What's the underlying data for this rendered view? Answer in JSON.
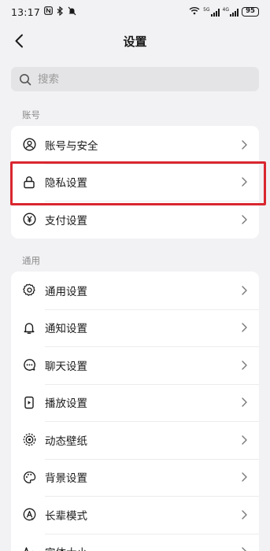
{
  "status_bar": {
    "time": "13:17",
    "left_icons": [
      "nfc-icon",
      "bluetooth-icon",
      "mute-icon"
    ],
    "network_1": "5G",
    "network_2": "4G",
    "battery": "95"
  },
  "header": {
    "title": "设置"
  },
  "search": {
    "placeholder": "搜索"
  },
  "sections": {
    "account": {
      "label": "账号",
      "items": [
        {
          "label": "账号与安全",
          "icon": "person-circle-icon"
        },
        {
          "label": "隐私设置",
          "icon": "lock-icon"
        },
        {
          "label": "支付设置",
          "icon": "yen-icon"
        }
      ]
    },
    "general": {
      "label": "通用",
      "items": [
        {
          "label": "通用设置",
          "icon": "gear-icon"
        },
        {
          "label": "通知设置",
          "icon": "bell-icon"
        },
        {
          "label": "聊天设置",
          "icon": "chat-bubble-icon"
        },
        {
          "label": "播放设置",
          "icon": "play-device-icon"
        },
        {
          "label": "动态壁纸",
          "icon": "live-wallpaper-icon"
        },
        {
          "label": "背景设置",
          "icon": "palette-icon"
        },
        {
          "label": "长辈模式",
          "icon": "elder-mode-icon"
        },
        {
          "label": "字体大小",
          "icon": "font-size-icon"
        }
      ]
    }
  },
  "highlight_color": "#d9262f"
}
